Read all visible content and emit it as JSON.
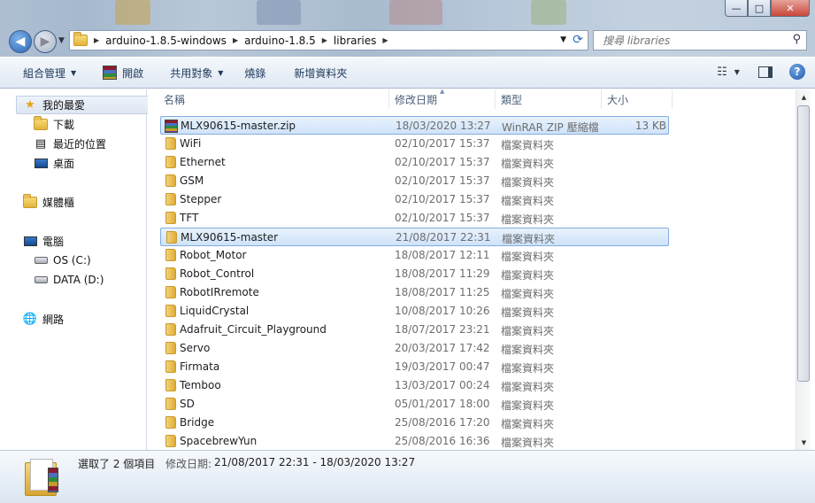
{
  "address": {
    "crumbs": [
      "arduino-1.8.5-windows",
      "arduino-1.8.5",
      "libraries"
    ]
  },
  "search": {
    "placeholder": "搜尋 libraries"
  },
  "toolbar": {
    "organize": "組合管理",
    "open": "開啟",
    "share": "共用對象",
    "burn": "燒錄",
    "new_folder": "新增資料夾"
  },
  "nav": {
    "favorites": "我的最愛",
    "downloads": "下載",
    "recent": "最近的位置",
    "desktop": "桌面",
    "libraries": "媒體櫃",
    "computer": "電腦",
    "drive_c": "OS (C:)",
    "drive_d": "DATA (D:)",
    "network": "網路"
  },
  "columns": {
    "name": "名稱",
    "date": "修改日期",
    "type": "類型",
    "size": "大小"
  },
  "files": [
    {
      "name": "MLX90615-master.zip",
      "date": "18/03/2020 13:27",
      "type": "WinRAR ZIP 壓縮檔",
      "size": "13 KB",
      "icon": "rar-zip-icon",
      "selected": true
    },
    {
      "name": "WiFi",
      "date": "02/10/2017 15:37",
      "type": "檔案資料夾",
      "size": "",
      "icon": "folder-icon",
      "selected": false
    },
    {
      "name": "Ethernet",
      "date": "02/10/2017 15:37",
      "type": "檔案資料夾",
      "size": "",
      "icon": "folder-icon",
      "selected": false
    },
    {
      "name": "GSM",
      "date": "02/10/2017 15:37",
      "type": "檔案資料夾",
      "size": "",
      "icon": "folder-icon",
      "selected": false
    },
    {
      "name": "Stepper",
      "date": "02/10/2017 15:37",
      "type": "檔案資料夾",
      "size": "",
      "icon": "folder-icon",
      "selected": false
    },
    {
      "name": "TFT",
      "date": "02/10/2017 15:37",
      "type": "檔案資料夾",
      "size": "",
      "icon": "folder-icon",
      "selected": false
    },
    {
      "name": "MLX90615-master",
      "date": "21/08/2017 22:31",
      "type": "檔案資料夾",
      "size": "",
      "icon": "folder-icon",
      "selected": true
    },
    {
      "name": "Robot_Motor",
      "date": "18/08/2017 12:11",
      "type": "檔案資料夾",
      "size": "",
      "icon": "folder-icon",
      "selected": false
    },
    {
      "name": "Robot_Control",
      "date": "18/08/2017 11:29",
      "type": "檔案資料夾",
      "size": "",
      "icon": "folder-icon",
      "selected": false
    },
    {
      "name": "RobotIRremote",
      "date": "18/08/2017 11:25",
      "type": "檔案資料夾",
      "size": "",
      "icon": "folder-icon",
      "selected": false
    },
    {
      "name": "LiquidCrystal",
      "date": "10/08/2017 10:26",
      "type": "檔案資料夾",
      "size": "",
      "icon": "folder-icon",
      "selected": false
    },
    {
      "name": "Adafruit_Circuit_Playground",
      "date": "18/07/2017 23:21",
      "type": "檔案資料夾",
      "size": "",
      "icon": "folder-icon",
      "selected": false
    },
    {
      "name": "Servo",
      "date": "20/03/2017 17:42",
      "type": "檔案資料夾",
      "size": "",
      "icon": "folder-icon",
      "selected": false
    },
    {
      "name": "Firmata",
      "date": "19/03/2017 00:47",
      "type": "檔案資料夾",
      "size": "",
      "icon": "folder-icon",
      "selected": false
    },
    {
      "name": "Temboo",
      "date": "13/03/2017 00:24",
      "type": "檔案資料夾",
      "size": "",
      "icon": "folder-icon",
      "selected": false
    },
    {
      "name": "SD",
      "date": "05/01/2017 18:00",
      "type": "檔案資料夾",
      "size": "",
      "icon": "folder-icon",
      "selected": false
    },
    {
      "name": "Bridge",
      "date": "25/08/2016 17:20",
      "type": "檔案資料夾",
      "size": "",
      "icon": "folder-icon",
      "selected": false
    },
    {
      "name": "SpacebrewYun",
      "date": "25/08/2016 16:36",
      "type": "檔案資料夾",
      "size": "",
      "icon": "folder-icon",
      "selected": false
    }
  ],
  "details": {
    "selection": "選取了 2 個項目",
    "modified_label": "修改日期:",
    "modified_value": "21/08/2017 22:31 - 18/03/2020 13:27"
  },
  "colors": {
    "selection_fill": "#cfe3fa",
    "selection_border": "#84acdd",
    "toolbar_text": "#1e395b"
  }
}
